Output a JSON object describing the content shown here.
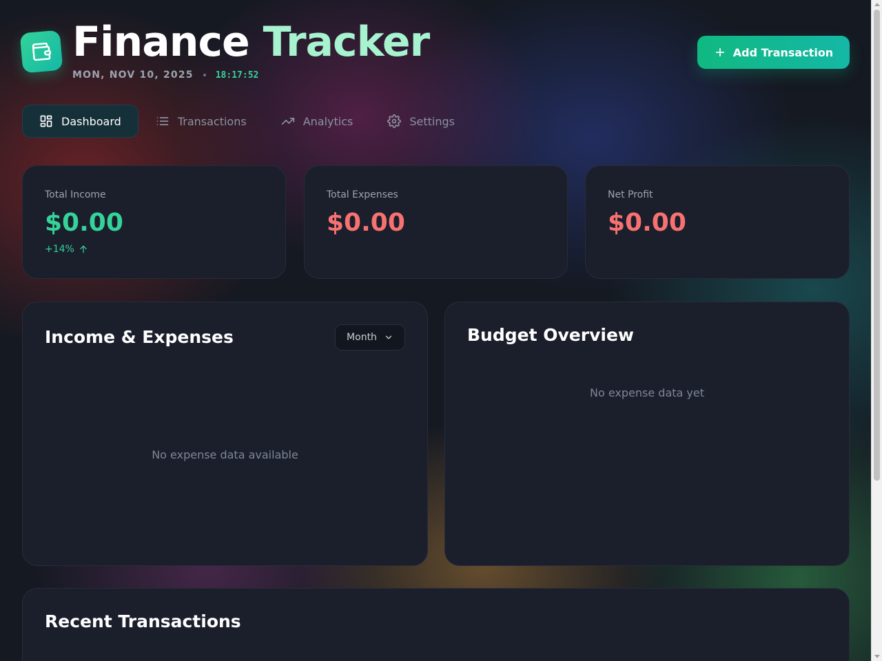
{
  "header": {
    "title_part1": "Finance",
    "title_part2": "Tracker",
    "date": "MON, NOV 10, 2025",
    "time": "18:17:52",
    "add_button_label": "Add Transaction"
  },
  "tabs": [
    {
      "label": "Dashboard",
      "icon": "dashboard-grid-icon",
      "active": true
    },
    {
      "label": "Transactions",
      "icon": "list-icon",
      "active": false
    },
    {
      "label": "Analytics",
      "icon": "trending-up-icon",
      "active": false
    },
    {
      "label": "Settings",
      "icon": "gear-icon",
      "active": false
    }
  ],
  "stats": [
    {
      "label": "Total Income",
      "value": "$0.00",
      "change": "+14%",
      "color": "#34d399"
    },
    {
      "label": "Total Expenses",
      "value": "$0.00",
      "color": "#f87171"
    },
    {
      "label": "Net Profit",
      "value": "$0.00",
      "color": "#f87171"
    }
  ],
  "income_expenses": {
    "title": "Income & Expenses",
    "period_selected": "Month",
    "empty_text": "No expense data available"
  },
  "budget": {
    "title": "Budget Overview",
    "empty_text": "No expense data yet"
  },
  "recent": {
    "title": "Recent Transactions"
  },
  "colors": {
    "accent": "#10b981",
    "income": "#34d399",
    "expense": "#f87171",
    "card_bg": "#1b1f2c"
  }
}
